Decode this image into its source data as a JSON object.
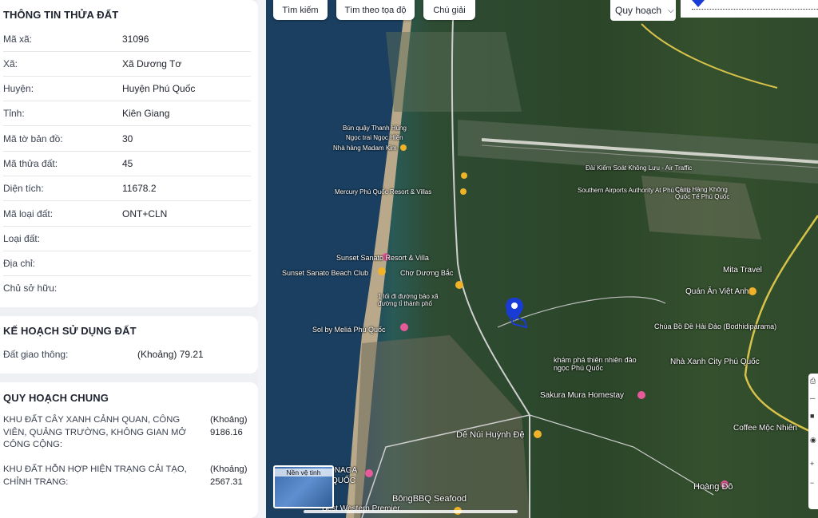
{
  "parcel": {
    "title": "THÔNG TIN THỬA ĐẤT",
    "rows": [
      {
        "label": "Mã xã:",
        "value": "31096"
      },
      {
        "label": "Xã:",
        "value": "Xã Dương Tơ"
      },
      {
        "label": "Huyện:",
        "value": "Huyện Phú Quốc"
      },
      {
        "label": "Tỉnh:",
        "value": "Kiên Giang"
      },
      {
        "label": "Mã tờ bản đồ:",
        "value": "30"
      },
      {
        "label": "Mã thửa đất:",
        "value": "45"
      },
      {
        "label": "Diện tích:",
        "value": "11678.2"
      },
      {
        "label": "Mã loại đất:",
        "value": "ONT+CLN"
      },
      {
        "label": "Loại đất:",
        "value": ""
      },
      {
        "label": "Địa chỉ:",
        "value": ""
      },
      {
        "label": "Chủ sở hữu:",
        "value": ""
      }
    ]
  },
  "land_use_plan": {
    "title": "KẾ HOẠCH SỬ DỤNG ĐẤT",
    "items": [
      {
        "label": "Đất giao thông:",
        "value": "(Khoảng) 79.21"
      }
    ]
  },
  "general_plan": {
    "title": "QUY HOẠCH CHUNG",
    "zones": [
      {
        "text": "KHU ĐẤT CÂY XANH CẢNH QUAN, CÔNG VIÊN, QUẢNG TRƯỜNG, KHÔNG GIAN MỞ CÔNG CỘNG:",
        "area": "(Khoảng) 9186.16"
      },
      {
        "text": "KHU ĐẤT HỖN HỢP HIỆN TRẠNG CẢI TẠO, CHỈNH TRANG:",
        "area": "(Khoảng) 2567.31"
      }
    ]
  },
  "toolbar": {
    "search": "Tìm kiếm",
    "coords": "Tìm theo tọa độ",
    "legend": "Chú giải",
    "layer_select": "Quy hoạch"
  },
  "minimap": {
    "label": "Nền vệ tinh"
  },
  "map_labels": {
    "sunset_sanato_resort": "Sunset Sanato Resort & Villa",
    "sunset_sanato_beach": "Sunset Sanato Beach Club",
    "cho_duong_bac": "Chợ Dương Bắc",
    "sol_melia": "Sol by Meliá Phú Quốc",
    "mercury": "Mercury Phú Quốc Resort & Villas",
    "bun_quay": "Bún quậy Thanh Hùng",
    "ngoc_trai": "Ngọc trai Ngọc Hiền",
    "madam_kim": "Nhà hàng Madam Kim",
    "airport_authority": "Southern Airports Authority At Phú Quốc",
    "dai_kiem_soat": "Đài Kiểm Soát Không Lưu - Air Traffic",
    "cang_hang_khong": "Cảng Hàng Không Quốc Tế Phú Quốc",
    "mita_travel": "Mita Travel",
    "quan_an_viet_anh": "Quán Ăn Việt Anh",
    "chua_bo_de": "Chùa Bồ Đề Hải Đảo (Bodhidiparama)",
    "kham_pha": "khám phá thiên nhiên đảo ngọc Phú Quốc",
    "nha_xanh": "Nhà Xanh City Phú Quốc",
    "sakura": "Sakura Mura Homestay",
    "de_nui": "Dế Núi Huỳnh Đệ",
    "coffee_moc": "Coffee Mộc Nhiên",
    "hoang_do": "Hoàng Đô",
    "bong_bbq": "BôngBBQ Seafood",
    "best_western": "Best Western Premier",
    "onaga": "ONAGA",
    "quoc": "QUỐC",
    "road_label": "1 lối đi đường bảo xã đường tỉ thành phố"
  },
  "colors": {
    "marker": "#1a3cd6",
    "sea": "#1b4464",
    "forest": "#2e4c33",
    "road": "#c9c9c9"
  }
}
